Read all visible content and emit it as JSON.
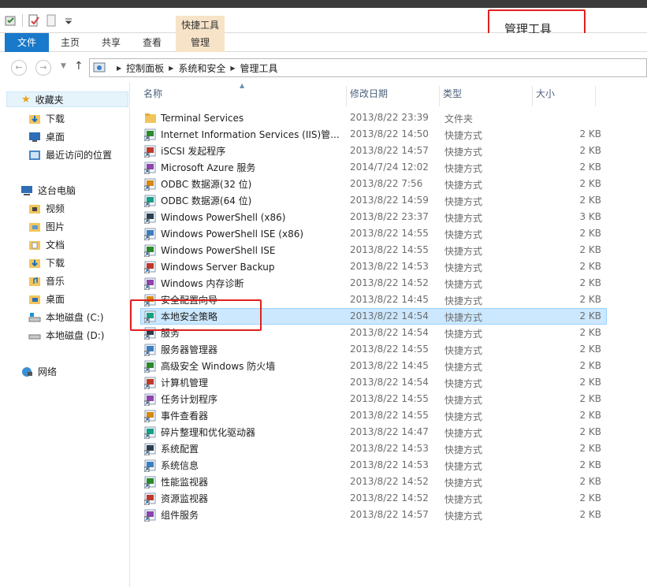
{
  "window": {
    "title": "管理工具",
    "context_tab_group": "快捷工具"
  },
  "ribbon": {
    "tabs": [
      "文件",
      "主页",
      "共享",
      "查看",
      "管理"
    ]
  },
  "address": {
    "crumbs": [
      "控制面板",
      "系统和安全",
      "管理工具"
    ]
  },
  "sidebar": {
    "favorites": {
      "label": "收藏夹",
      "items": [
        "下载",
        "桌面",
        "最近访问的位置"
      ]
    },
    "this_pc": {
      "label": "这台电脑",
      "items": [
        "视频",
        "图片",
        "文档",
        "下载",
        "音乐",
        "桌面",
        "本地磁盘 (C:)",
        "本地磁盘 (D:)"
      ]
    },
    "network": {
      "label": "网络"
    }
  },
  "columns": {
    "name": "名称",
    "date": "修改日期",
    "type": "类型",
    "size": "大小"
  },
  "files": [
    {
      "name": "Terminal Services",
      "date": "2013/8/22 23:39",
      "type": "文件夹",
      "size": "",
      "icon": "folder-icon"
    },
    {
      "name": "Internet Information Services (IIS)管...",
      "date": "2013/8/22 14:50",
      "type": "快捷方式",
      "size": "2 KB",
      "icon": "iis-shortcut-icon"
    },
    {
      "name": "iSCSI 发起程序",
      "date": "2013/8/22 14:57",
      "type": "快捷方式",
      "size": "2 KB",
      "icon": "iscsi-shortcut-icon"
    },
    {
      "name": "Microsoft Azure 服务",
      "date": "2014/7/24 12:02",
      "type": "快捷方式",
      "size": "2 KB",
      "icon": "azure-shortcut-icon"
    },
    {
      "name": "ODBC 数据源(32 位)",
      "date": "2013/8/22 7:56",
      "type": "快捷方式",
      "size": "2 KB",
      "icon": "odbc-shortcut-icon"
    },
    {
      "name": "ODBC 数据源(64 位)",
      "date": "2013/8/22 14:59",
      "type": "快捷方式",
      "size": "2 KB",
      "icon": "odbc-shortcut-icon"
    },
    {
      "name": "Windows PowerShell (x86)",
      "date": "2013/8/22 23:37",
      "type": "快捷方式",
      "size": "3 KB",
      "icon": "powershell-shortcut-icon"
    },
    {
      "name": "Windows PowerShell ISE (x86)",
      "date": "2013/8/22 14:55",
      "type": "快捷方式",
      "size": "2 KB",
      "icon": "powershell-ise-shortcut-icon"
    },
    {
      "name": "Windows PowerShell ISE",
      "date": "2013/8/22 14:55",
      "type": "快捷方式",
      "size": "2 KB",
      "icon": "powershell-ise-shortcut-icon"
    },
    {
      "name": "Windows Server Backup",
      "date": "2013/8/22 14:53",
      "type": "快捷方式",
      "size": "2 KB",
      "icon": "backup-shortcut-icon"
    },
    {
      "name": "Windows 内存诊断",
      "date": "2013/8/22 14:52",
      "type": "快捷方式",
      "size": "2 KB",
      "icon": "memory-diagnostic-shortcut-icon"
    },
    {
      "name": "安全配置向导",
      "date": "2013/8/22 14:45",
      "type": "快捷方式",
      "size": "2 KB",
      "icon": "security-wizard-shortcut-icon"
    },
    {
      "name": "本地安全策略",
      "date": "2013/8/22 14:54",
      "type": "快捷方式",
      "size": "2 KB",
      "icon": "local-security-policy-shortcut-icon"
    },
    {
      "name": "服务",
      "date": "2013/8/22 14:54",
      "type": "快捷方式",
      "size": "2 KB",
      "icon": "services-shortcut-icon"
    },
    {
      "name": "服务器管理器",
      "date": "2013/8/22 14:55",
      "type": "快捷方式",
      "size": "2 KB",
      "icon": "server-manager-shortcut-icon"
    },
    {
      "name": "高级安全 Windows 防火墙",
      "date": "2013/8/22 14:45",
      "type": "快捷方式",
      "size": "2 KB",
      "icon": "firewall-shortcut-icon"
    },
    {
      "name": "计算机管理",
      "date": "2013/8/22 14:54",
      "type": "快捷方式",
      "size": "2 KB",
      "icon": "computer-management-shortcut-icon"
    },
    {
      "name": "任务计划程序",
      "date": "2013/8/22 14:55",
      "type": "快捷方式",
      "size": "2 KB",
      "icon": "task-scheduler-shortcut-icon"
    },
    {
      "name": "事件查看器",
      "date": "2013/8/22 14:55",
      "type": "快捷方式",
      "size": "2 KB",
      "icon": "event-viewer-shortcut-icon"
    },
    {
      "name": "碎片整理和优化驱动器",
      "date": "2013/8/22 14:47",
      "type": "快捷方式",
      "size": "2 KB",
      "icon": "defrag-shortcut-icon"
    },
    {
      "name": "系统配置",
      "date": "2013/8/22 14:53",
      "type": "快捷方式",
      "size": "2 KB",
      "icon": "system-config-shortcut-icon"
    },
    {
      "name": "系统信息",
      "date": "2013/8/22 14:53",
      "type": "快捷方式",
      "size": "2 KB",
      "icon": "system-info-shortcut-icon"
    },
    {
      "name": "性能监视器",
      "date": "2013/8/22 14:52",
      "type": "快捷方式",
      "size": "2 KB",
      "icon": "performance-monitor-shortcut-icon"
    },
    {
      "name": "资源监视器",
      "date": "2013/8/22 14:52",
      "type": "快捷方式",
      "size": "2 KB",
      "icon": "resource-monitor-shortcut-icon"
    },
    {
      "name": "组件服务",
      "date": "2013/8/22 14:57",
      "type": "快捷方式",
      "size": "2 KB",
      "icon": "component-services-shortcut-icon"
    }
  ],
  "selected_file": "本地安全策略",
  "colors": {
    "ribbon_file": "#1979ca",
    "context_tab": "#f7e3c8",
    "selection": "#cce8ff",
    "highlight_box": "#e02020"
  }
}
